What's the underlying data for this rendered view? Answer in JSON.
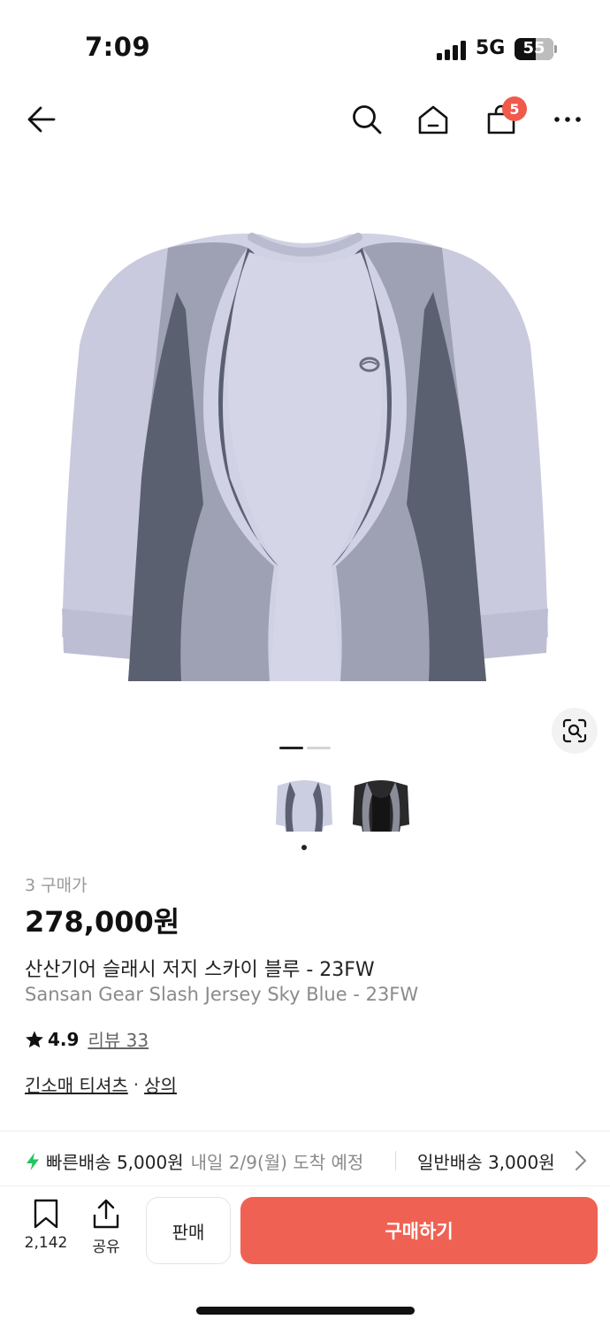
{
  "status_bar": {
    "time": "7:09",
    "network": "5G",
    "battery": "55"
  },
  "header": {
    "cart_count": "5"
  },
  "gallery": {
    "page_count": 2,
    "current_page": 1
  },
  "product": {
    "purchase_label": "3 구매가",
    "price": "278,000원",
    "name_ko": "산산기어 슬래시 저지 스카이 블루 - 23FW",
    "name_en": "Sansan Gear Slash Jersey Sky Blue - 23FW",
    "rating": "4.9",
    "review_label": "리뷰 33",
    "category_main": "긴소매 티셔츠",
    "category_separator": "·",
    "category_sub": "상의"
  },
  "shipping": {
    "fast_label": "빠른배송 5,000원",
    "fast_eta": "내일 2/9(월) 도착 예정",
    "normal_label": "일반배송 3,000원"
  },
  "bottom_bar": {
    "save_count": "2,142",
    "share_label": "공유",
    "sell_label": "판매",
    "buy_label": "구매하기"
  },
  "colors": {
    "accent": "#ef6253",
    "badge": "#ef5a4d",
    "fast_shipping_icon": "#22c55e",
    "shirt_main": "#cfd0e3",
    "shirt_mid": "#9c9fb0",
    "shirt_dark": "#5a5f6e"
  }
}
